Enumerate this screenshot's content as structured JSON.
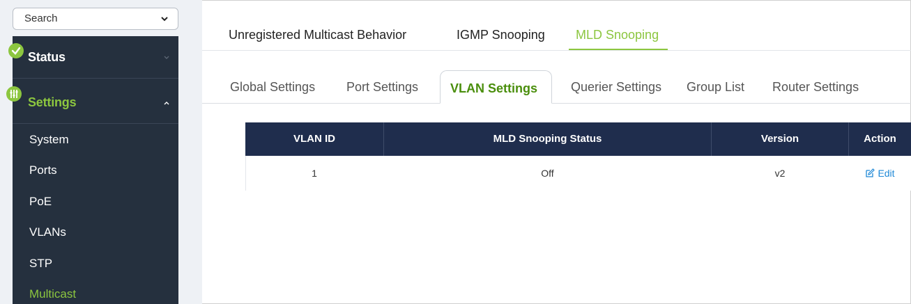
{
  "sidebar": {
    "search": {
      "label": "Search"
    },
    "status": {
      "label": "Status"
    },
    "settings": {
      "label": "Settings"
    },
    "items": [
      {
        "label": "System"
      },
      {
        "label": "Ports"
      },
      {
        "label": "PoE"
      },
      {
        "label": "VLANs"
      },
      {
        "label": "STP"
      },
      {
        "label": "Multicast",
        "active": true
      }
    ]
  },
  "top_tabs": [
    {
      "label": "Unregistered Multicast Behavior"
    },
    {
      "label": "IGMP Snooping"
    },
    {
      "label": "MLD Snooping",
      "active": true
    }
  ],
  "sub_tabs": [
    {
      "label": "Global Settings"
    },
    {
      "label": "Port Settings"
    },
    {
      "label": "VLAN Settings",
      "active": true
    },
    {
      "label": "Querier Settings"
    },
    {
      "label": "Group List"
    },
    {
      "label": "Router Settings"
    }
  ],
  "table": {
    "headers": [
      "VLAN ID",
      "MLD Snooping Status",
      "Version",
      "Action"
    ],
    "rows": [
      {
        "vlan_id": "1",
        "status": "Off",
        "version": "v2",
        "action": "Edit"
      }
    ]
  },
  "colors": {
    "accent": "#8cc63f",
    "sidebar_dark": "#25303e",
    "table_header": "#1f2d4d",
    "link": "#1e88d6"
  },
  "icons": {
    "search_dropdown": "chevron-down-icon",
    "status_badge": "check-circle-icon",
    "settings_badge": "sliders-icon",
    "edit": "edit-icon"
  }
}
